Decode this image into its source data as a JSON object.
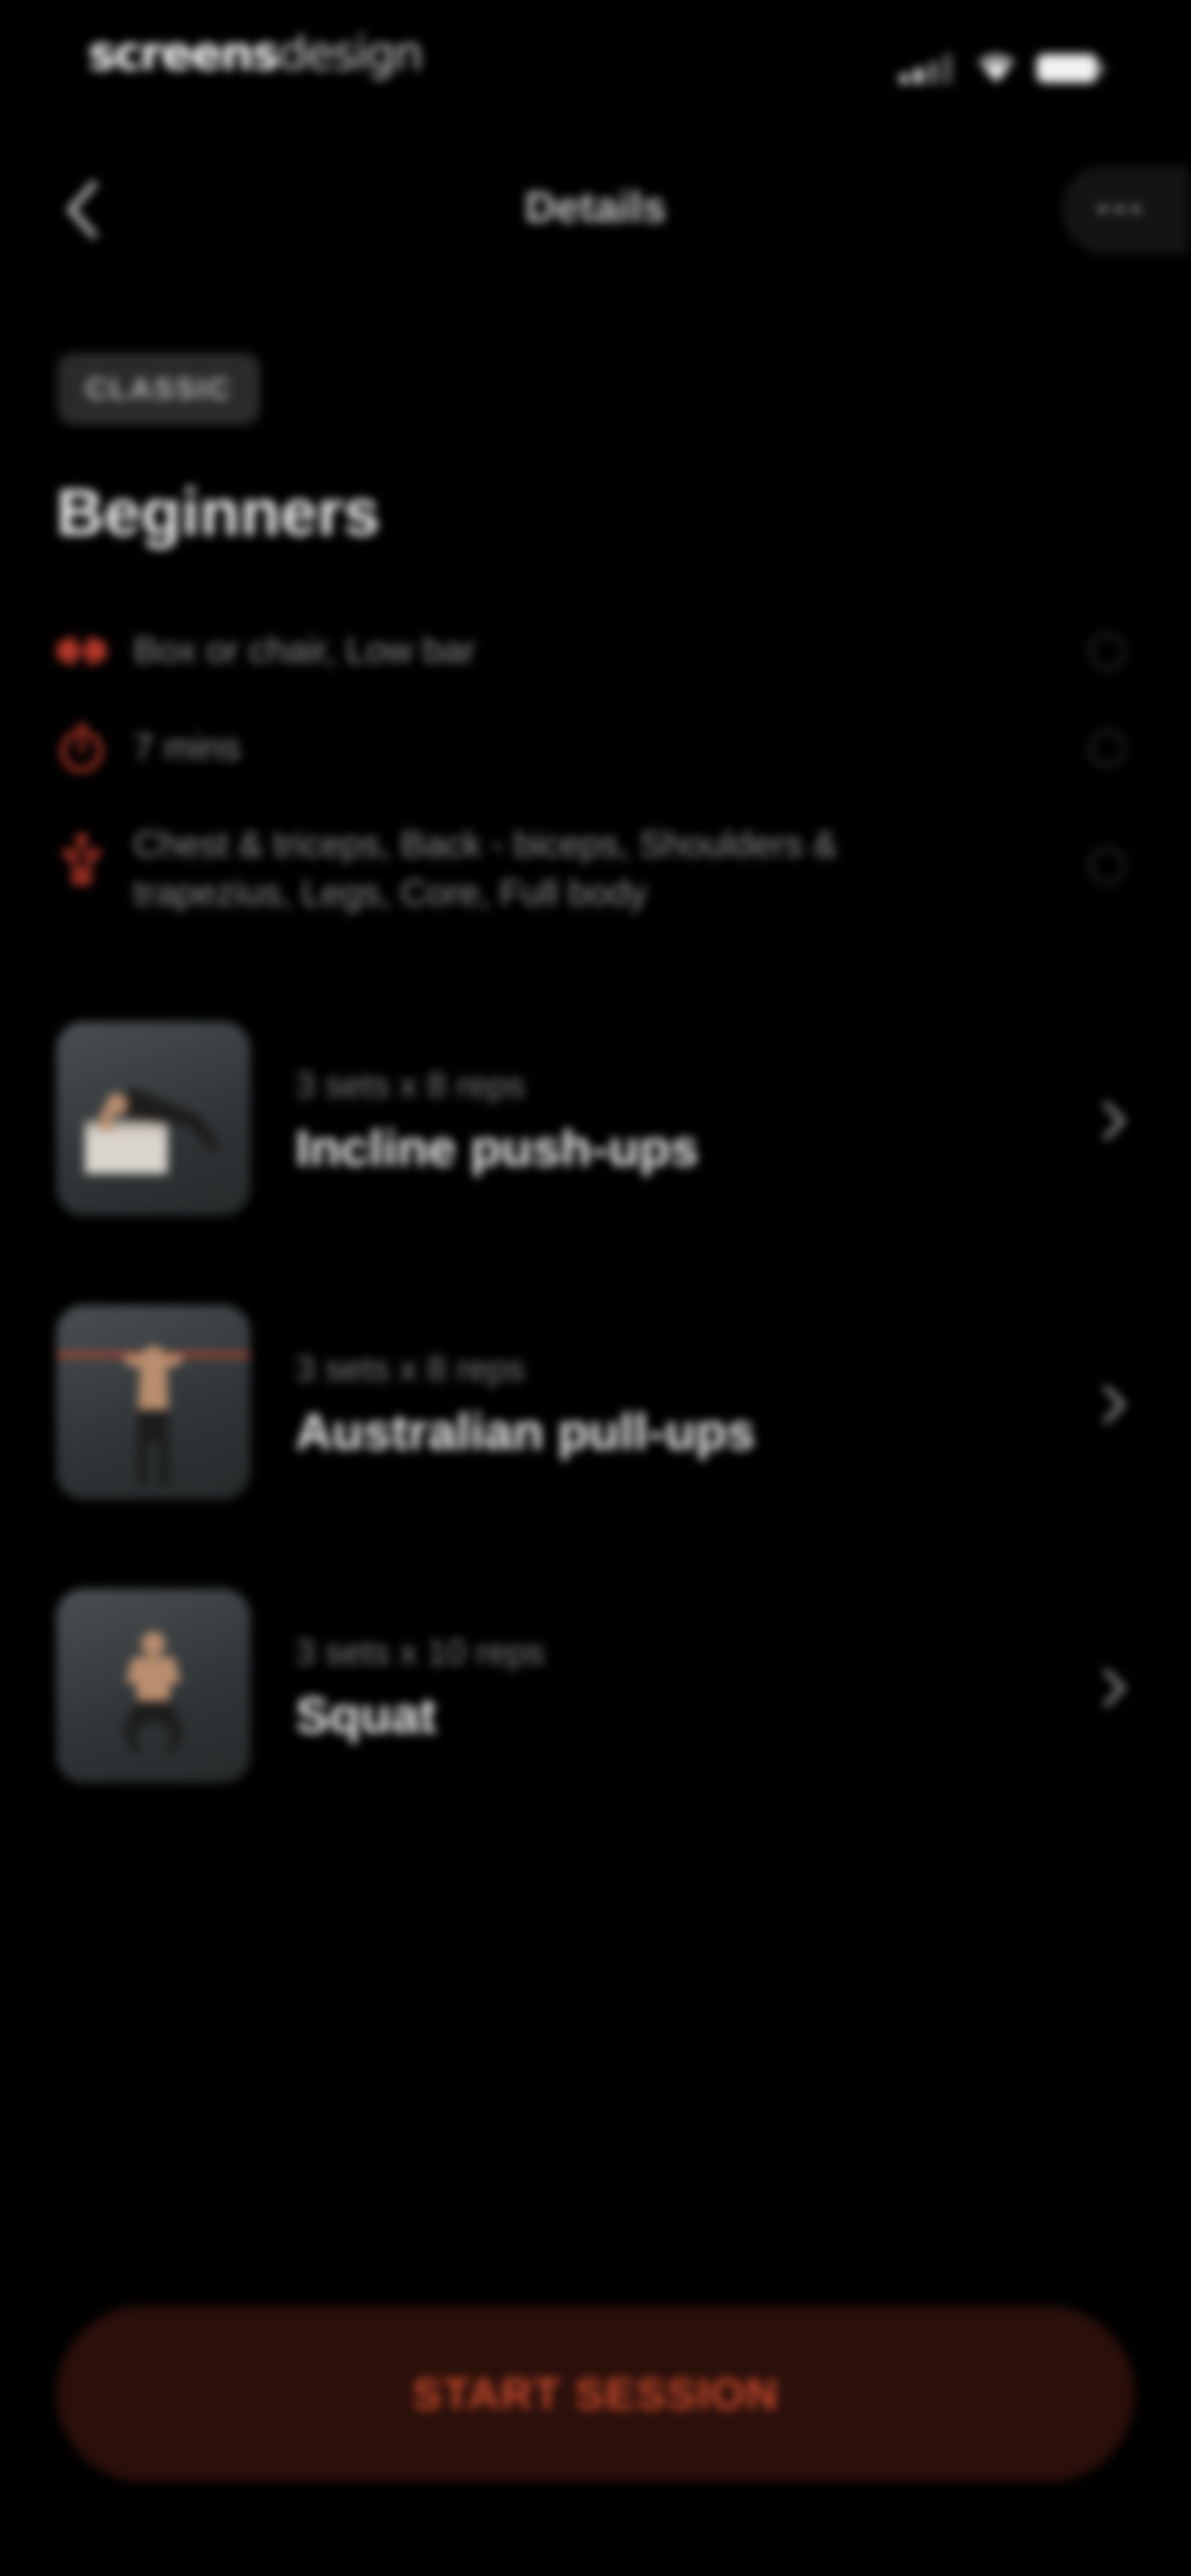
{
  "status_bar": {
    "brand_bold": "screens",
    "brand_light": "design"
  },
  "nav": {
    "title": "Details",
    "back_icon": "chevron-left-icon",
    "more_icon": "ellipsis-icon"
  },
  "workout": {
    "badge": "CLASSIC",
    "title": "Beginners",
    "info": [
      {
        "icon": "dumbbell-icon",
        "text": "Box or chair, Low bar"
      },
      {
        "icon": "stopwatch-icon",
        "text": "7 mins"
      },
      {
        "icon": "body-muscle-icon",
        "text": "Chest & triceps, Back - biceps, Shoulders & trapezius, Legs, Core, Full body"
      }
    ]
  },
  "exercises": [
    {
      "meta": "3 sets x 8 reps",
      "name": "Incline push-ups"
    },
    {
      "meta": "3 sets x 8 reps",
      "name": "Australian pull-ups"
    },
    {
      "meta": "3 sets x 10 reps",
      "name": "Squat"
    }
  ],
  "cta": {
    "label": "START SESSION"
  },
  "colors": {
    "background": "#000000",
    "accent": "#c44a2c",
    "cta_background": "#2a0f0a",
    "badge_background": "#2a2a2a"
  }
}
